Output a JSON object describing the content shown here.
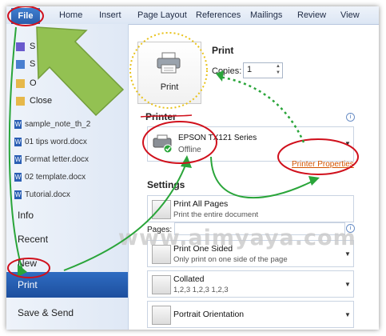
{
  "ribbon": {
    "file": "File",
    "tabs": [
      "Home",
      "Insert",
      "Page Layout",
      "References",
      "Mailings",
      "Review",
      "View"
    ]
  },
  "leftpane": {
    "partial_items": [
      "S",
      "S",
      "O",
      "Close"
    ],
    "recent_docs": [
      "sample_note_th_2",
      "01 tips word.docx",
      "Format letter.docx",
      "02 template.docx",
      "Tutorial.docx"
    ],
    "info": "Info",
    "recent": "Recent",
    "new": "New",
    "print": "Print",
    "save_send": "Save & Send"
  },
  "print": {
    "heading": "Print",
    "button_label": "Print",
    "copies_label": "Copies:",
    "copies_value": "1"
  },
  "printer": {
    "heading": "Printer",
    "name": "EPSON TX121 Series",
    "status": "Offline",
    "properties_link": "Printer Properties"
  },
  "settings": {
    "heading": "Settings",
    "items": [
      {
        "title": "Print All Pages",
        "subtitle": "Print the entire document"
      },
      {
        "title": "Print One Sided",
        "subtitle": "Only print on one side of the page"
      },
      {
        "title": "Collated",
        "subtitle": "1,2,3    1,2,3    1,2,3"
      },
      {
        "title": "Portrait Orientation",
        "subtitle": ""
      }
    ],
    "pages_label": "Pages:"
  },
  "watermark": "www.aimyaya.com",
  "colors": {
    "file_tab": "#2f6cc2",
    "selected_print": "#1d4f9e",
    "annotation_red": "#d0101c",
    "annotation_green": "#2aa53a",
    "annotation_yellow": "#e8c21a",
    "link_orange": "#d35400"
  }
}
